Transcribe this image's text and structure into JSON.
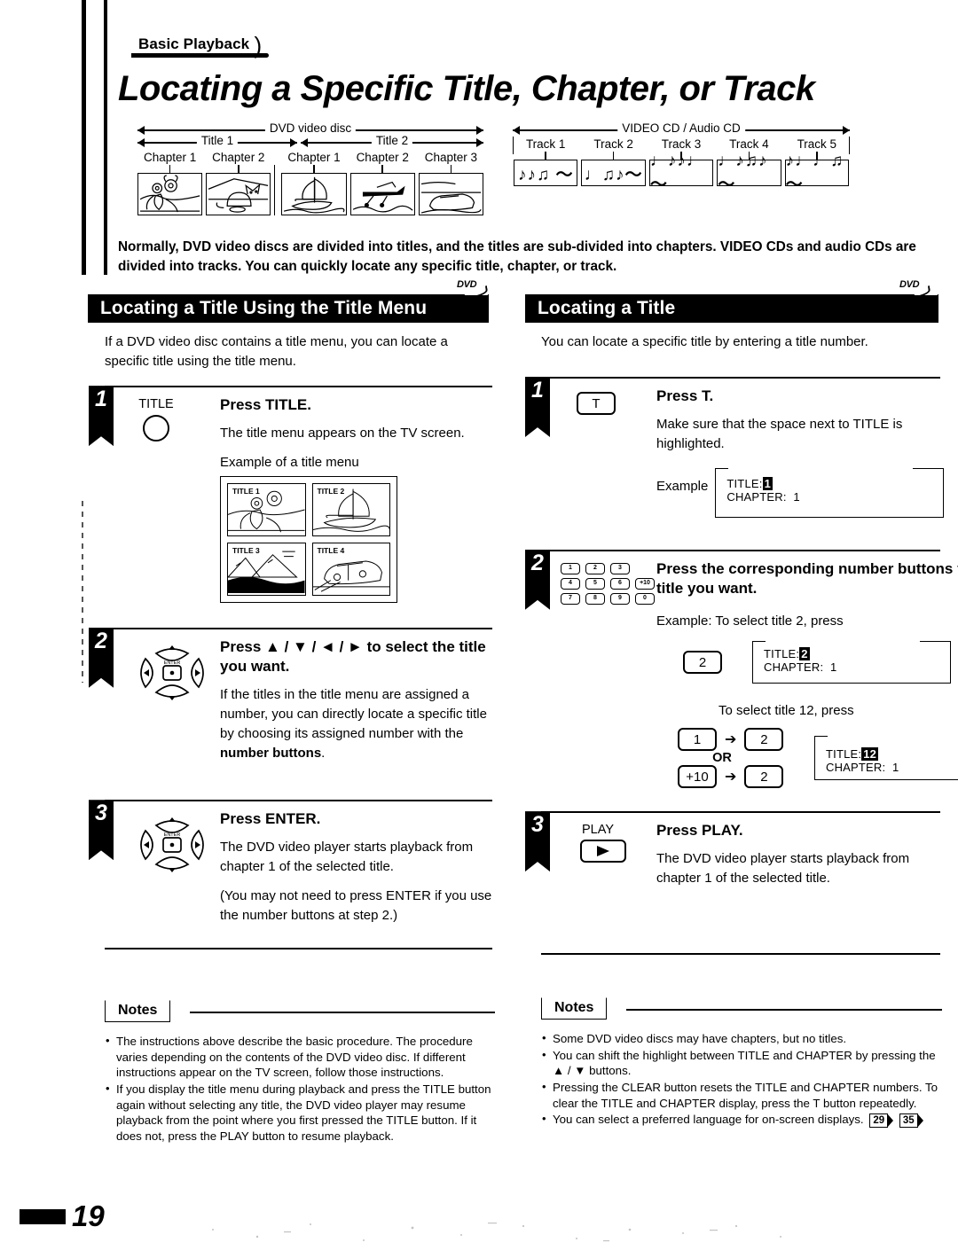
{
  "header": {
    "kicker": "Basic Playback",
    "title": "Locating a Specific Title, Chapter, or Track"
  },
  "diagram": {
    "dvd": {
      "top_label": "DVD video disc",
      "titles": [
        "Title 1",
        "Title 2"
      ],
      "chapters_title1": [
        "Chapter 1",
        "Chapter 2"
      ],
      "chapters_title2": [
        "Chapter 1",
        "Chapter 2",
        "Chapter 3"
      ]
    },
    "cd": {
      "top_label": "VIDEO CD / Audio CD",
      "tracks": [
        "Track 1",
        "Track 2",
        "Track 3",
        "Track 4",
        "Track 5"
      ],
      "track_notes": [
        "♪♪♫ ～",
        "♩♫♪～",
        "♩♪♪♩～",
        "♩♪♫♪～",
        "♪♩♩♫～"
      ]
    }
  },
  "intro": "Normally, DVD video discs are divided into titles, and the titles are sub-divided into chapters. VIDEO CDs and audio CDs are divided into tracks. You can quickly locate any specific title, chapter, or track.",
  "left_section": {
    "banner": "Locating a Title Using the Title Menu",
    "badge": "DVD",
    "lead": "If a DVD video disc contains a title menu, you can locate a specific title using the title menu.",
    "steps": [
      {
        "num": "1",
        "key_label": "TITLE",
        "title": "Press TITLE.",
        "p1": "The title menu appears on the TV screen.",
        "p2": "Example of a title menu",
        "menu_cells": [
          "TITLE 1",
          "TITLE 2",
          "TITLE 3",
          "TITLE 4"
        ]
      },
      {
        "num": "2",
        "title": "Press ▲ / ▼ / ◄ / ► to select the title you want.",
        "p1_a": "If the titles in the title menu are assigned a number, you can directly locate a specific title by choosing its assigned number with the ",
        "p1_b": "number buttons",
        "p1_c": "."
      },
      {
        "num": "3",
        "title": "Press ENTER.",
        "p1": "The DVD video player starts playback from chapter 1 of the selected title.",
        "p2": "(You may not need to press ENTER if you use the number buttons at step 2.)"
      }
    ]
  },
  "right_section": {
    "banner": "Locating a Title",
    "badge": "DVD",
    "lead": "You can locate a specific title by entering a title number.",
    "steps": [
      {
        "num": "1",
        "key_btn": "T",
        "title": "Press T.",
        "p1": "Make sure that the space next to TITLE is highlighted.",
        "example_label": "Example",
        "osd": {
          "title_row_label": "TITLE:",
          "title_value": "1",
          "chapter_row_label": "CHAPTER:",
          "chapter_value": "1"
        }
      },
      {
        "num": "2",
        "numpad": [
          "1",
          "2",
          "3",
          "",
          "4",
          "5",
          "6",
          "+10",
          "7",
          "8",
          "9",
          "0"
        ],
        "title": "Press the corresponding number buttons for the title you want.",
        "ex1_label": "Example: To select title 2, press",
        "ex1_key": "2",
        "ex1_osd": {
          "title_row_label": "TITLE:",
          "title_value": "2",
          "chapter_row_label": "CHAPTER:",
          "chapter_value": "1"
        },
        "ex2_label": "To select title 12, press",
        "ex2_key_a": "1",
        "ex2_key_b": "2",
        "ex2_or": "OR",
        "ex2_key_c": "+10",
        "ex2_key_d": "2",
        "ex2_osd": {
          "title_row_label": "TITLE:",
          "title_value": "12",
          "chapter_row_label": "CHAPTER:",
          "chapter_value": "1"
        }
      },
      {
        "num": "3",
        "key_label": "PLAY",
        "title": "Press PLAY.",
        "p1": "The DVD video player starts playback from chapter 1 of the selected title."
      }
    ]
  },
  "notes_left": {
    "heading": "Notes",
    "items": [
      "The instructions above describe the basic procedure. The procedure varies depending on the contents of the DVD video disc. If different instructions appear on the TV screen, follow those instructions.",
      "If you display the title menu during playback and press the TITLE button again without selecting any title, the DVD video player may resume playback from the point where you first pressed the TITLE button. If it does not, press the PLAY button to resume playback."
    ]
  },
  "notes_right": {
    "heading": "Notes",
    "items": [
      "Some DVD video discs may have chapters, but no titles.",
      "You can shift the highlight between TITLE and CHAPTER by pressing the ▲ / ▼ buttons.",
      "Pressing the CLEAR button resets the TITLE and CHAPTER numbers. To clear the TITLE and CHAPTER display, press the T button repeatedly."
    ],
    "last_item": "You can select a preferred language for on-screen displays.",
    "page_refs": [
      "29",
      "35"
    ]
  },
  "footer": {
    "page_number": "19"
  }
}
